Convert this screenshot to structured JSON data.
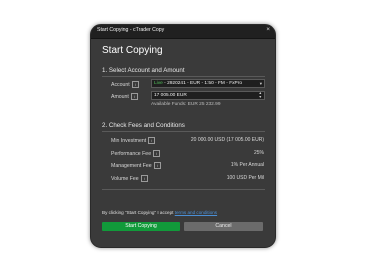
{
  "window": {
    "title": "Start Copying - cTrader Copy",
    "close_glyph": "×"
  },
  "heading": "Start Copying",
  "section1": {
    "title": "1. Select Account and Amount",
    "account_label": "Account",
    "account_status": "Live",
    "account_value": " - 2920241 - EUR - 1:50 - FM - FxPro",
    "amount_label": "Amount",
    "amount_value": "17 005.00 EUR",
    "available_funds": "Available Funds: EUR 25 232.99"
  },
  "section2": {
    "title": "2. Check Fees and Conditions",
    "rows": [
      {
        "label": "Min Investment",
        "value": "20 000.00 USD (17 005.00 EUR)"
      },
      {
        "label": "Performance Fee",
        "value": "25%"
      },
      {
        "label": "Management Fee",
        "value": "1% Per Annual"
      },
      {
        "label": "Volume Fee",
        "value": "100 USD Per Mil"
      }
    ]
  },
  "notice": {
    "prefix": "By clicking \"Start Copying\" I accept",
    "link_text": "terms and conditions"
  },
  "buttons": {
    "start": "Start Copying",
    "cancel": "Cancel"
  },
  "colors": {
    "accent_green": "#119a3a",
    "live_green": "#52c25a",
    "link_blue": "#4a8fd6",
    "dialog_bg": "#3a3a3a"
  }
}
